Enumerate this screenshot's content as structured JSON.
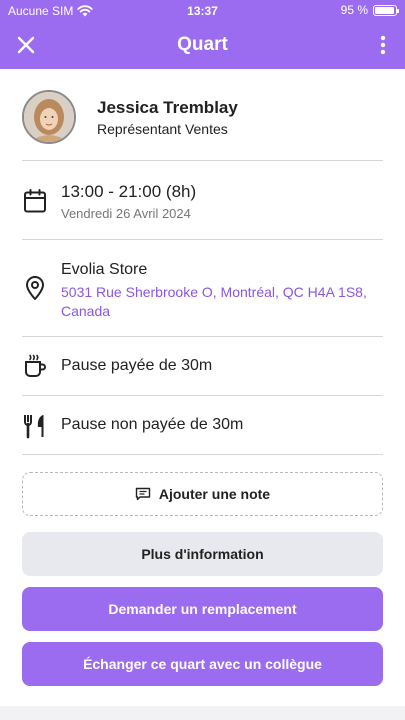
{
  "status_bar": {
    "carrier": "Aucune SIM",
    "time": "13:37",
    "battery_text": "95 %",
    "battery_level": 0.95
  },
  "header": {
    "title": "Quart",
    "close_icon": "close-icon",
    "menu_icon": "vertical-dots-icon"
  },
  "employee": {
    "name": "Jessica Tremblay",
    "role": "Représentant Ventes"
  },
  "shift": {
    "time_range": "13:00 - 21:00 (8h)",
    "date": "Vendredi 26 Avril 2024"
  },
  "location": {
    "name": "Evolia Store",
    "address": "5031 Rue Sherbrooke O, Montréal, QC H4A 1S8, Canada"
  },
  "breaks": {
    "paid": "Pause payée de 30m",
    "unpaid": "Pause non payée de 30m"
  },
  "actions": {
    "add_note": "Ajouter une note",
    "more_info": "Plus d'information",
    "request_replacement": "Demander un remplacement",
    "swap_shift": "Échanger ce quart avec un collègue"
  },
  "colors": {
    "accent": "#9b6bf0",
    "link": "#8b55e6",
    "gray_button": "#e8e9ee",
    "divider": "#d6d6d6"
  }
}
